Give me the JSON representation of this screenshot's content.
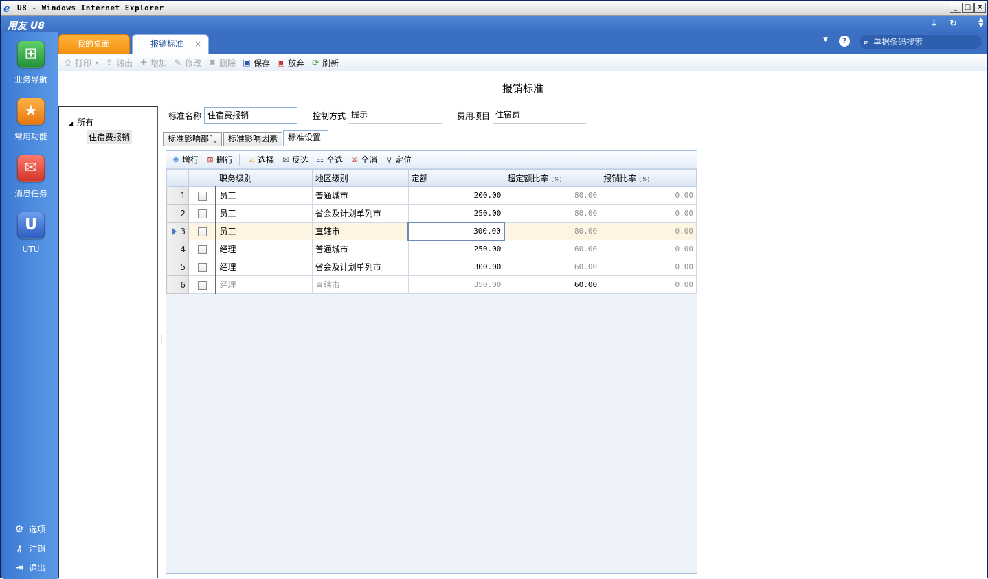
{
  "window": {
    "title": "U8 - Windows Internet Explorer",
    "controls": [
      "_",
      "□",
      "×"
    ]
  },
  "app": {
    "brand": "用友 U8"
  },
  "sidebar": {
    "items": [
      {
        "label": "业务导航",
        "icon": "business-nav-icon",
        "color": "#3aa648"
      },
      {
        "label": "常用功能",
        "icon": "star-icon",
        "color": "#f08a1c"
      },
      {
        "label": "消息任务",
        "icon": "mail-icon",
        "color": "#e0443a"
      },
      {
        "label": "UTU",
        "icon": "utu-icon",
        "color": "#3b6fd0"
      }
    ],
    "bottom": [
      {
        "label": "选项",
        "icon": "gear-icon"
      },
      {
        "label": "注销",
        "icon": "key-icon"
      },
      {
        "label": "退出",
        "icon": "exit-icon"
      }
    ]
  },
  "tabs": {
    "home": "我的桌面",
    "current": "报销标准",
    "close": "×"
  },
  "search": {
    "placeholder": "单据条码搜索"
  },
  "help": "?",
  "toolbar": {
    "print": "打印",
    "export": "输出",
    "add": "增加",
    "edit": "修改",
    "delete": "删除",
    "save": "保存",
    "discard": "放弃",
    "refresh": "刷新"
  },
  "page": {
    "title": "报销标准"
  },
  "tree": {
    "root": "所有",
    "child": "住宿费报销"
  },
  "form": {
    "name_label": "标准名称",
    "name_value": "住宿费报销",
    "control_label": "控制方式",
    "control_value": "提示",
    "expense_label": "费用项目",
    "expense_value": "住宿费"
  },
  "subtabs": [
    "标准影响部门",
    "标准影响因素",
    "标准设置"
  ],
  "grid_toolbar": {
    "add_row": "增行",
    "del_row": "删行",
    "select": "选择",
    "invert": "反选",
    "select_all": "全选",
    "clear_all": "全消",
    "locate": "定位"
  },
  "grid": {
    "columns": [
      "职务级别",
      "地区级别",
      "定额",
      "超定额比率",
      "报销比率"
    ],
    "pct": "(%)",
    "rows": [
      {
        "no": "1",
        "level": "员工",
        "region": "普通城市",
        "quota": "200.00",
        "over": "80.00",
        "reimb": "0.00"
      },
      {
        "no": "2",
        "level": "员工",
        "region": "省会及计划单列市",
        "quota": "250.00",
        "over": "80.00",
        "reimb": "0.00"
      },
      {
        "no": "3",
        "level": "员工",
        "region": "直辖市",
        "quota": "300.00",
        "over": "80.00",
        "reimb": "0.00"
      },
      {
        "no": "4",
        "level": "经理",
        "region": "普通城市",
        "quota": "250.00",
        "over": "60.00",
        "reimb": "0.00"
      },
      {
        "no": "5",
        "level": "经理",
        "region": "省会及计划单列市",
        "quota": "300.00",
        "over": "60.00",
        "reimb": "0.00"
      },
      {
        "no": "6",
        "level": "经理",
        "region": "直辖市",
        "quota": "350.00",
        "over": "60.00",
        "reimb": "0.00"
      }
    ]
  }
}
